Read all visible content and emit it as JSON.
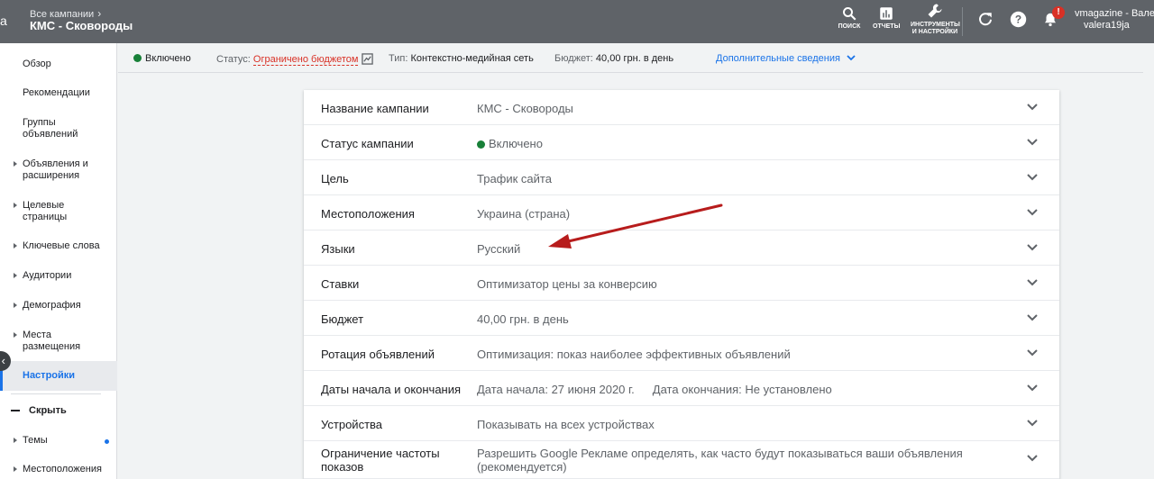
{
  "topbar": {
    "logo_fragment": "a",
    "breadcrumb": "Все кампании",
    "campaign_name": "КМС - Сковороды",
    "search_label": "ПОИСК",
    "reports_label": "ОТЧЕТЫ",
    "tools_label_1": "ИНСТРУМЕНТЫ",
    "tools_label_2": "И НАСТРОЙКИ",
    "notification_count": "!",
    "account_name": "vmagazine - Валери",
    "account_email": "valera19ja"
  },
  "statusbar": {
    "enabled": "Включено",
    "status_label": "Статус:",
    "status_value": "Ограничено бюджетом",
    "type_label": "Тип:",
    "type_value": "Контекстно-медийная сеть",
    "budget_label": "Бюджет:",
    "budget_value": "40,00 грн. в день",
    "more_info": "Дополнительные сведения"
  },
  "sidebar": {
    "items": [
      {
        "label": "Обзор"
      },
      {
        "label": "Рекомендации"
      },
      {
        "label": "Группы",
        "label2": "объявлений"
      },
      {
        "label": "Объявления и",
        "label2": "расширения"
      },
      {
        "label": "Целевые",
        "label2": "страницы"
      },
      {
        "label": "Ключевые слова"
      },
      {
        "label": "Аудитории"
      },
      {
        "label": "Демография"
      },
      {
        "label": "Места",
        "label2": "размещения"
      },
      {
        "label": "Настройки"
      },
      {
        "label": "Темы"
      },
      {
        "label": "Местоположения"
      }
    ],
    "hide_label": "Скрыть"
  },
  "settings": {
    "rows": [
      {
        "name": "Название кампании",
        "value": "КМС - Сковороды"
      },
      {
        "name": "Статус кампании",
        "value": "Включено"
      },
      {
        "name": "Цель",
        "value": "Трафик сайта"
      },
      {
        "name": "Местоположения",
        "value": "Украина (страна)"
      },
      {
        "name": "Языки",
        "value": "Русский"
      },
      {
        "name": "Ставки",
        "value": "Оптимизатор цены за конверсию"
      },
      {
        "name": "Бюджет",
        "value": "40,00 грн. в день"
      },
      {
        "name": "Ротация объявлений",
        "value": "Оптимизация: показ наиболее эффективных объявлений"
      },
      {
        "name": "Даты начала и окончания",
        "value": "Дата начала: 27 июня 2020 г.",
        "value2": "Дата окончания: Не установлено"
      },
      {
        "name": "Устройства",
        "value": "Показывать на всех устройствах"
      },
      {
        "name": "Ограничение частоты показов",
        "value": "Разрешить Google Рекламе определять, как часто будут показываться ваши объявления (рекомендуется)"
      }
    ]
  },
  "colors": {
    "topbar": "#5f6368",
    "accent": "#1a73e8",
    "status_limited": "#d93025",
    "enabled_green": "#188038",
    "annotation_arrow": "#b71c1c"
  }
}
